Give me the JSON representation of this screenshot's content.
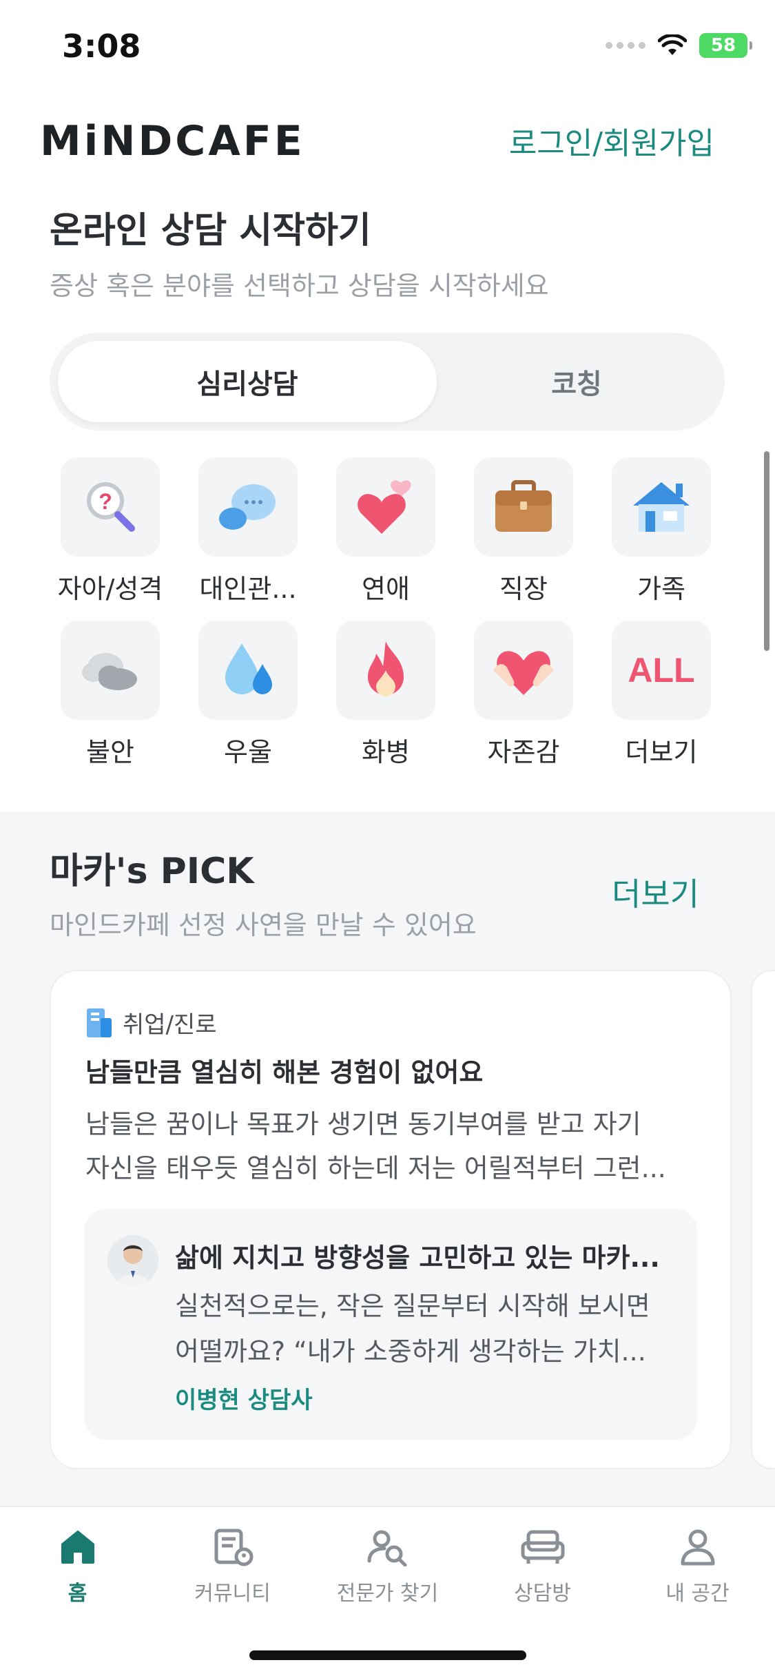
{
  "status_bar": {
    "time": "3:08",
    "battery": "58"
  },
  "header": {
    "logo": "MiNDCAFE",
    "login": "로그인/회원가입"
  },
  "consult": {
    "title": "온라인 상담 시작하기",
    "subtitle": "증상 혹은 분야를 선택하고 상담을 시작하세요",
    "tabs": [
      "심리상담",
      "코칭"
    ],
    "categories": [
      {
        "label": "자아/성격",
        "icon": "magnifier-question-icon"
      },
      {
        "label": "대인관...",
        "icon": "chat-bubbles-icon"
      },
      {
        "label": "연애",
        "icon": "hearts-icon"
      },
      {
        "label": "직장",
        "icon": "briefcase-icon"
      },
      {
        "label": "가족",
        "icon": "house-icon"
      },
      {
        "label": "불안",
        "icon": "cloud-icon"
      },
      {
        "label": "우울",
        "icon": "water-drops-icon"
      },
      {
        "label": "화병",
        "icon": "fire-icon"
      },
      {
        "label": "자존감",
        "icon": "heart-hands-icon"
      },
      {
        "label": "더보기",
        "icon": "all-icon",
        "icon_text": "ALL"
      }
    ]
  },
  "pick": {
    "title": "마카's PICK",
    "subtitle": "마인드카페 선정 사연을 만날 수 있어요",
    "more": "더보기",
    "card": {
      "category": "취업/진로",
      "title": "남들만큼 열심히 해본 경험이 없어요",
      "body_lines": [
        "남들은 꿈이나 목표가 생기면 동기부여를 받고 자기",
        "자신을 태우듯 열심히 하는데 저는 어릴적부터 그런..."
      ],
      "reply": {
        "title": "삶에 지치고 방향성을 고민하고 있는 마카...",
        "body_lines": [
          "실천적으로는, 작은 질문부터 시작해 보시면",
          "어떨까요? “내가 소중하게 생각하는 가치..."
        ],
        "author": "이병현 상담사"
      }
    }
  },
  "tabbar": [
    {
      "label": "홈",
      "icon": "home-icon",
      "active": true
    },
    {
      "label": "커뮤니티",
      "icon": "community-icon",
      "active": false
    },
    {
      "label": "전문가 찾기",
      "icon": "find-expert-icon",
      "active": false
    },
    {
      "label": "상담방",
      "icon": "sofa-icon",
      "active": false
    },
    {
      "label": "내 공간",
      "icon": "profile-icon",
      "active": false
    }
  ],
  "colors": {
    "accent": "#1b8a7f",
    "text": "#2b2f33",
    "muted": "#9aa0a6"
  }
}
